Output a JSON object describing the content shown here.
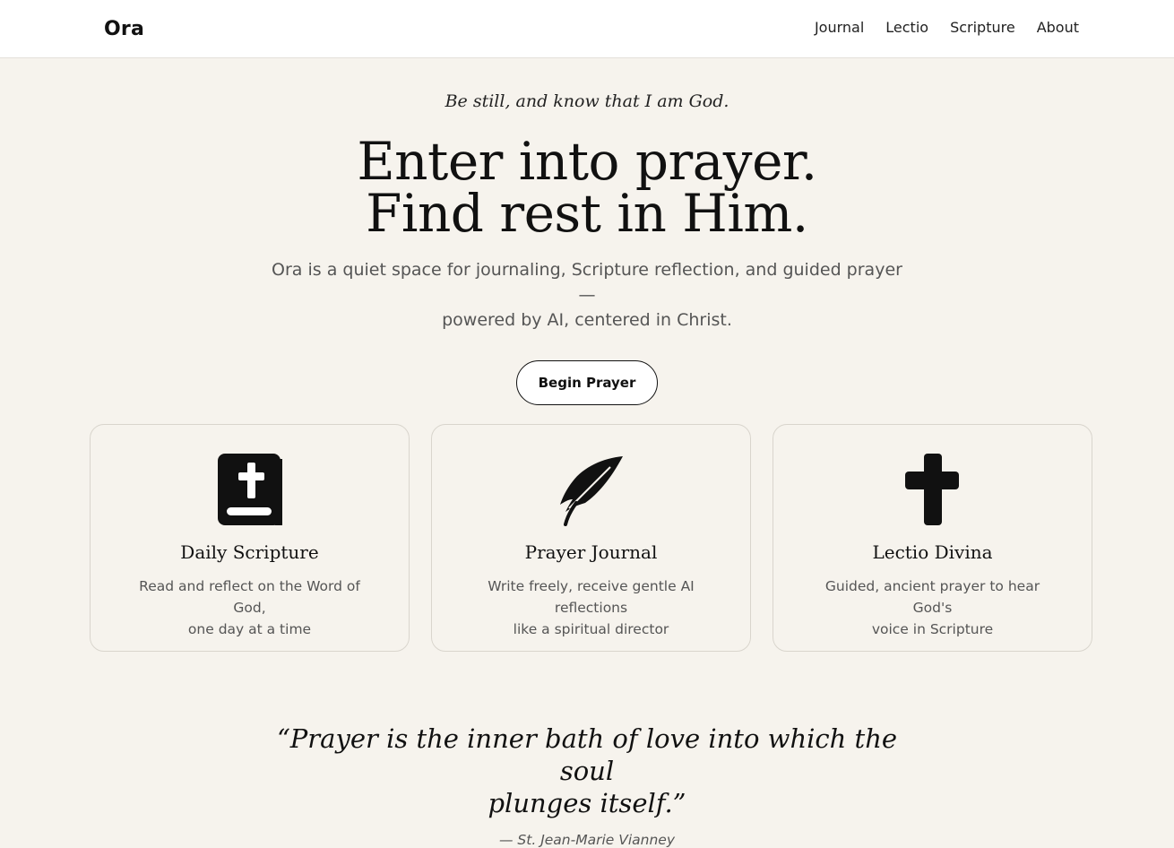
{
  "brand": "Ora",
  "nav": {
    "items": [
      "Journal",
      "Lectio",
      "Scripture",
      "About"
    ]
  },
  "hero": {
    "tagline": "Be still, and know that I am God.",
    "headline_line1": "Enter into prayer.",
    "headline_line2": "Find rest in Him.",
    "subtitle_line1": "Ora is a quiet space for journaling, Scripture reflection, and guided prayer—",
    "subtitle_line2": "powered by AI, centered in Christ.",
    "cta_label": "Begin Prayer"
  },
  "cards": [
    {
      "icon": "bible-icon",
      "title": "Daily Scripture",
      "desc_line1": "Read and reflect on the Word of God,",
      "desc_line2": "one day at a time"
    },
    {
      "icon": "feather-icon",
      "title": "Prayer Journal",
      "desc_line1": "Write freely, receive gentle AI reflections",
      "desc_line2": "like a spiritual director"
    },
    {
      "icon": "cross-icon",
      "title": "Lectio Divina",
      "desc_line1": "Guided, ancient prayer to hear God's",
      "desc_line2": "voice in Scripture"
    }
  ],
  "quote": {
    "text_line1": "“Prayer is the inner bath of love into which the soul",
    "text_line2": "plunges itself.”",
    "attribution": "— St. Jean-Marie Vianney"
  },
  "colors": {
    "background": "#f6f3ed",
    "header": "#ffffff",
    "text": "#111111",
    "muted": "#555555",
    "border": "#d9d5cd"
  }
}
